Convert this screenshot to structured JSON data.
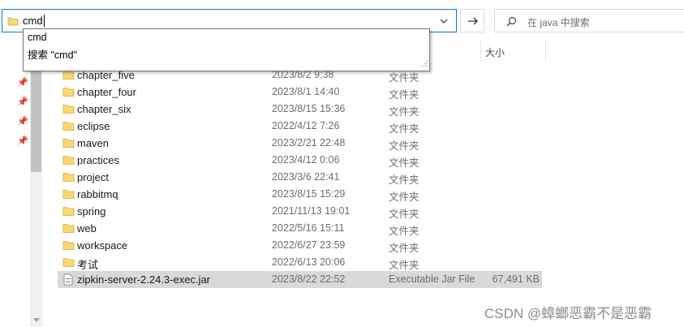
{
  "address_bar": {
    "value": "cmd"
  },
  "search": {
    "placeholder": "在 java 中搜索"
  },
  "autocomplete": {
    "items": [
      "cmd",
      "搜索 \"cmd\""
    ]
  },
  "columns": {
    "size": "大小"
  },
  "files": [
    {
      "name": "chapter_five",
      "date": "2023/8/2 9:38",
      "type": "文件夹",
      "size": "",
      "kind": "folder"
    },
    {
      "name": "chapter_four",
      "date": "2023/8/1 14:40",
      "type": "文件夹",
      "size": "",
      "kind": "folder"
    },
    {
      "name": "chapter_six",
      "date": "2023/8/15 15:36",
      "type": "文件夹",
      "size": "",
      "kind": "folder"
    },
    {
      "name": "eclipse",
      "date": "2022/4/12 7:26",
      "type": "文件夹",
      "size": "",
      "kind": "folder"
    },
    {
      "name": "maven",
      "date": "2023/2/21 22:48",
      "type": "文件夹",
      "size": "",
      "kind": "folder"
    },
    {
      "name": "practices",
      "date": "2023/4/12 0:06",
      "type": "文件夹",
      "size": "",
      "kind": "folder"
    },
    {
      "name": "project",
      "date": "2023/3/6 22:41",
      "type": "文件夹",
      "size": "",
      "kind": "folder"
    },
    {
      "name": "rabbitmq",
      "date": "2023/8/15 15:29",
      "type": "文件夹",
      "size": "",
      "kind": "folder"
    },
    {
      "name": "spring",
      "date": "2021/11/13 19:01",
      "type": "文件夹",
      "size": "",
      "kind": "folder"
    },
    {
      "name": "web",
      "date": "2022/5/16 15:11",
      "type": "文件夹",
      "size": "",
      "kind": "folder"
    },
    {
      "name": "workspace",
      "date": "2022/6/27 23:59",
      "type": "文件夹",
      "size": "",
      "kind": "folder"
    },
    {
      "name": "考试",
      "date": "2022/6/13 20:06",
      "type": "文件夹",
      "size": "",
      "kind": "folder"
    },
    {
      "name": "zipkin-server-2.24.3-exec.jar",
      "date": "2023/8/22 22:52",
      "type": "Executable Jar File",
      "size": "67,491 KB",
      "kind": "jar"
    }
  ],
  "watermark": "CSDN @蟑螂恶霸不是恶霸",
  "colors": {
    "accent": "#0078d7",
    "folder": "#f8d775",
    "selected_row": "#d9d9d9"
  },
  "icons": [
    "folder-icon",
    "chevron-down-icon",
    "arrow-right-icon",
    "search-icon",
    "pin-icon",
    "jar-file-icon"
  ]
}
